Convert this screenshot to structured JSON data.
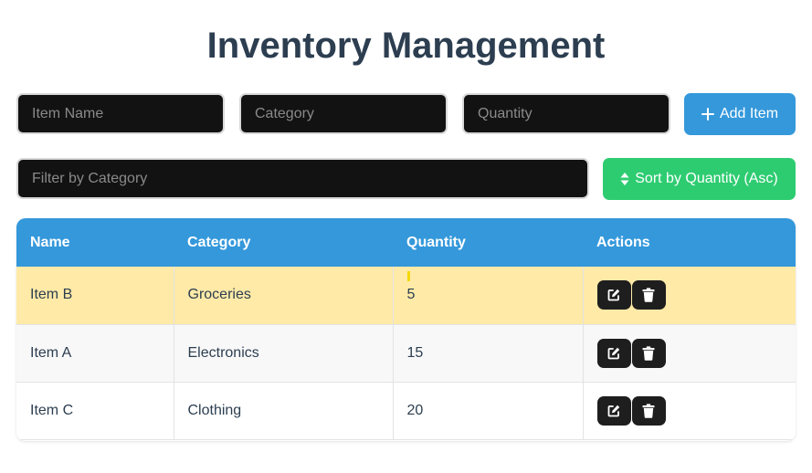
{
  "page": {
    "title": "Inventory Management"
  },
  "form": {
    "name_placeholder": "Item Name",
    "category_placeholder": "Category",
    "quantity_placeholder": "Quantity",
    "add_label": "Add Item",
    "add_icon": "plus-icon"
  },
  "filter": {
    "placeholder": "Filter by Category",
    "sort_label": "Sort by Quantity (Asc)",
    "sort_icon": "sort-icon"
  },
  "table": {
    "headers": {
      "name": "Name",
      "category": "Category",
      "quantity": "Quantity",
      "actions": "Actions"
    },
    "rows": [
      {
        "name": "Item B",
        "category": "Groceries",
        "quantity": "5",
        "highlighted": true
      },
      {
        "name": "Item A",
        "category": "Electronics",
        "quantity": "15",
        "highlighted": false
      },
      {
        "name": "Item C",
        "category": "Clothing",
        "quantity": "20",
        "highlighted": false
      }
    ],
    "action_icons": [
      "edit-icon",
      "trash-icon"
    ]
  },
  "colors": {
    "primary": "#3498db",
    "success": "#2ecc71",
    "highlight_row": "#ffeaa7",
    "heading": "#2c3e50",
    "input_bg": "#121212"
  }
}
